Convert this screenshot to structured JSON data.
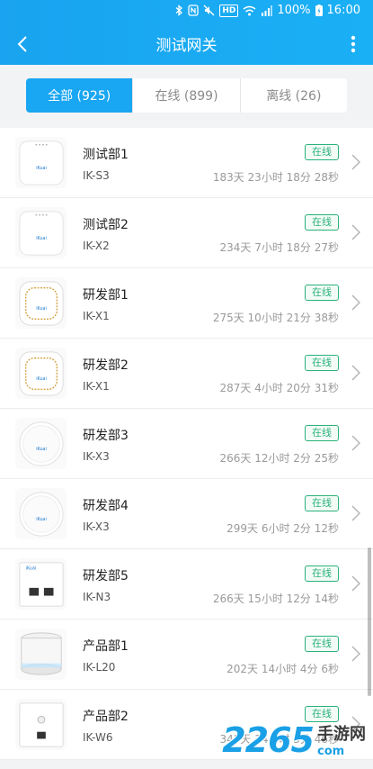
{
  "status": {
    "battery": "100%",
    "time": "16:00",
    "hd": "HD"
  },
  "header": {
    "title": "测试网关"
  },
  "tabs": [
    {
      "label": "全部 (925)",
      "active": true
    },
    {
      "label": "在线 (899)",
      "active": false
    },
    {
      "label": "离线 (26)",
      "active": false
    }
  ],
  "devices": [
    {
      "name": "测试部1",
      "model": "IK-S3",
      "status": "在线",
      "uptime": "183天 23小时 18分 28秒",
      "thumb": "ceiling-ap"
    },
    {
      "name": "测试部2",
      "model": "IK-X2",
      "status": "在线",
      "uptime": "234天 7小时 18分 27秒",
      "thumb": "ceiling-ap"
    },
    {
      "name": "研发部1",
      "model": "IK-X1",
      "status": "在线",
      "uptime": "275天 10小时 21分 38秒",
      "thumb": "square-ap"
    },
    {
      "name": "研发部2",
      "model": "IK-X1",
      "status": "在线",
      "uptime": "287天 4小时 20分 31秒",
      "thumb": "square-ap"
    },
    {
      "name": "研发部3",
      "model": "IK-X3",
      "status": "在线",
      "uptime": "266天 12小时 2分 25秒",
      "thumb": "round-ap"
    },
    {
      "name": "研发部4",
      "model": "IK-X3",
      "status": "在线",
      "uptime": "299天 6小时 2分 12秒",
      "thumb": "round-ap"
    },
    {
      "name": "研发部5",
      "model": "IK-N3",
      "status": "在线",
      "uptime": "266天 15小时 12分 14秒",
      "thumb": "wall-ap"
    },
    {
      "name": "产品部1",
      "model": "IK-L20",
      "status": "在线",
      "uptime": "202天 14小时 4分 6秒",
      "thumb": "cylinder-ap"
    },
    {
      "name": "产品部2",
      "model": "IK-W6",
      "status": "在线",
      "uptime": "345天 14小时 3分 46秒",
      "thumb": "panel-ap"
    }
  ],
  "watermark": {
    "num": "2265",
    "domain": "com",
    "cn": "手游网"
  }
}
